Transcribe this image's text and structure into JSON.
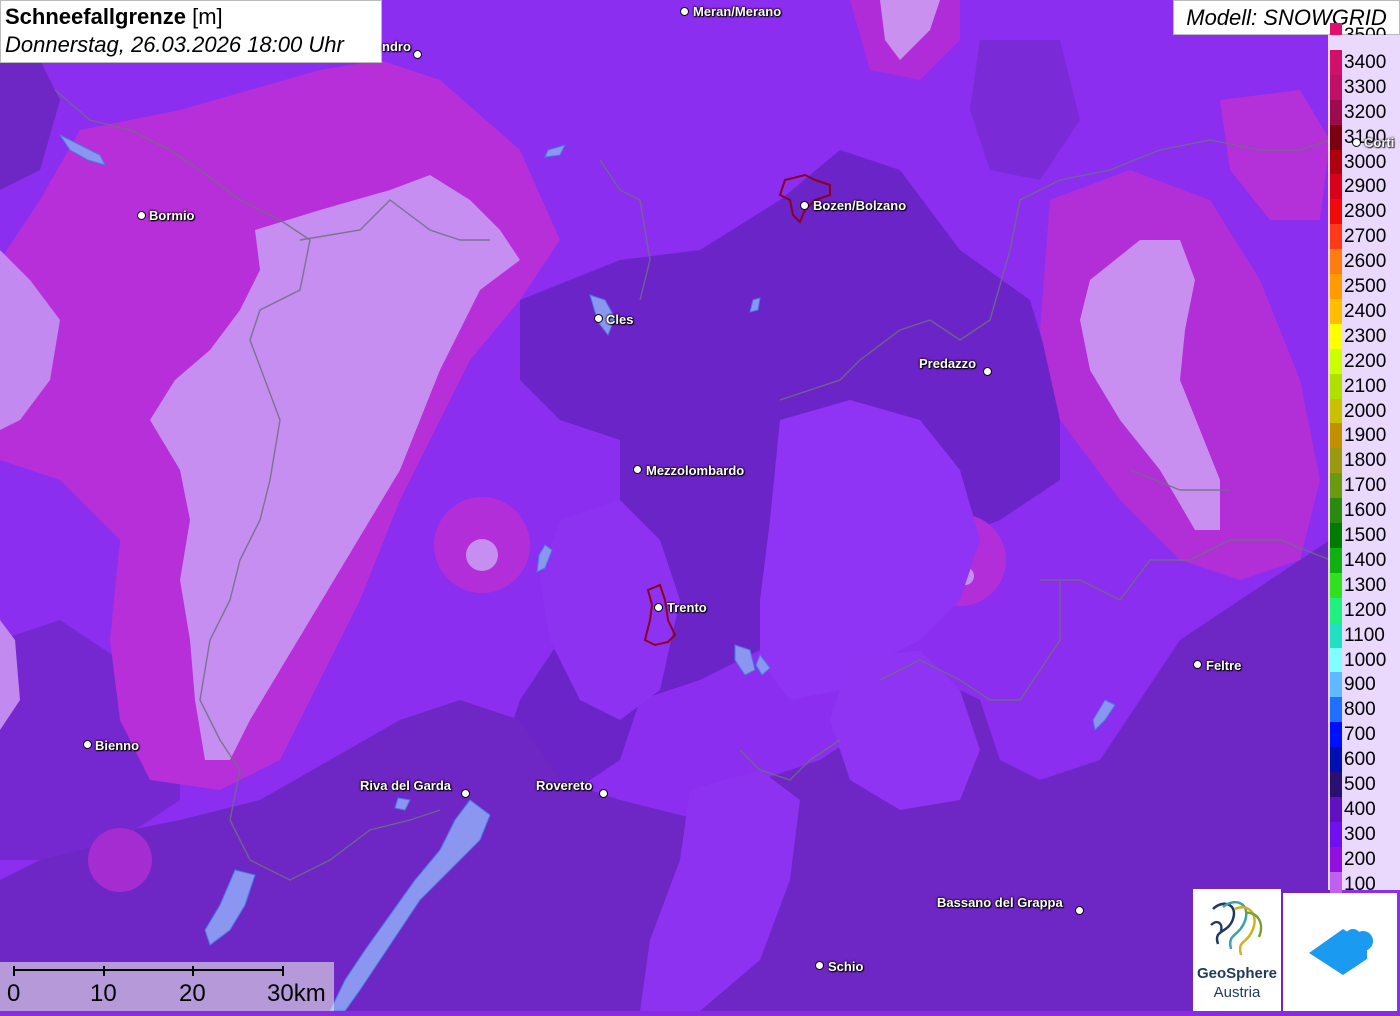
{
  "header": {
    "title": "Schneefallgrenze",
    "unit": "[m]",
    "datetime": "Donnerstag, 26.03.2026 18:00 Uhr"
  },
  "model": {
    "label": "Modell: SNOWGRID"
  },
  "legend": {
    "items": [
      {
        "label": "3500",
        "color": "#e0106e"
      },
      {
        "label": "3400",
        "color": "#d0106a"
      },
      {
        "label": "3300",
        "color": "#c00f66"
      },
      {
        "label": "3200",
        "color": "#9e0a4e"
      },
      {
        "label": "3100",
        "color": "#7a0010"
      },
      {
        "label": "3000",
        "color": "#b00010"
      },
      {
        "label": "2900",
        "color": "#d8001a"
      },
      {
        "label": "2800",
        "color": "#f00a0a"
      },
      {
        "label": "2700",
        "color": "#ff3a1a"
      },
      {
        "label": "2600",
        "color": "#ff7d10"
      },
      {
        "label": "2500",
        "color": "#ff9a00"
      },
      {
        "label": "2400",
        "color": "#ffbe00"
      },
      {
        "label": "2300",
        "color": "#ffff00"
      },
      {
        "label": "2200",
        "color": "#ccff00"
      },
      {
        "label": "2100",
        "color": "#b0e000"
      },
      {
        "label": "2000",
        "color": "#c8c000"
      },
      {
        "label": "1900",
        "color": "#c09000"
      },
      {
        "label": "1800",
        "color": "#9a9a10"
      },
      {
        "label": "1700",
        "color": "#6a9a10"
      },
      {
        "label": "1600",
        "color": "#2a8a10"
      },
      {
        "label": "1500",
        "color": "#007a00"
      },
      {
        "label": "1400",
        "color": "#10b010"
      },
      {
        "label": "1300",
        "color": "#30e020"
      },
      {
        "label": "1200",
        "color": "#20f080"
      },
      {
        "label": "1100",
        "color": "#20e0c0"
      },
      {
        "label": "1000",
        "color": "#80ffff"
      },
      {
        "label": "900",
        "color": "#60b8ff"
      },
      {
        "label": "800",
        "color": "#2070ff"
      },
      {
        "label": "700",
        "color": "#0010ff"
      },
      {
        "label": "600",
        "color": "#0010b0"
      },
      {
        "label": "500",
        "color": "#2a1070"
      },
      {
        "label": "400",
        "color": "#6010c0"
      },
      {
        "label": "300",
        "color": "#7010f0"
      },
      {
        "label": "200",
        "color": "#9010e0"
      },
      {
        "label": "100",
        "color": "#c060f0"
      }
    ]
  },
  "cities": [
    {
      "name": "Meran/Merano"
    },
    {
      "name": "ndro"
    },
    {
      "name": "Bormio"
    },
    {
      "name": "Bozen/Bolzano"
    },
    {
      "name": "Cles"
    },
    {
      "name": "Predazzo"
    },
    {
      "name": "Mezzolombardo"
    },
    {
      "name": "Trento"
    },
    {
      "name": "Feltre"
    },
    {
      "name": "Bienno"
    },
    {
      "name": "Riva del Garda"
    },
    {
      "name": "Rovereto"
    },
    {
      "name": "Bassano del Grappa"
    },
    {
      "name": "Schio"
    },
    {
      "name": "Corti"
    }
  ],
  "scale": {
    "labels": [
      "0",
      "10",
      "20",
      "30km"
    ]
  },
  "logos": {
    "geosphere_line1": "GeoSphere",
    "geosphere_line2": "Austria"
  },
  "colors": {
    "base": "#8a2be2",
    "dark": "#6a22c0",
    "light": "#c993f0",
    "magenta": "#b02ad8"
  }
}
